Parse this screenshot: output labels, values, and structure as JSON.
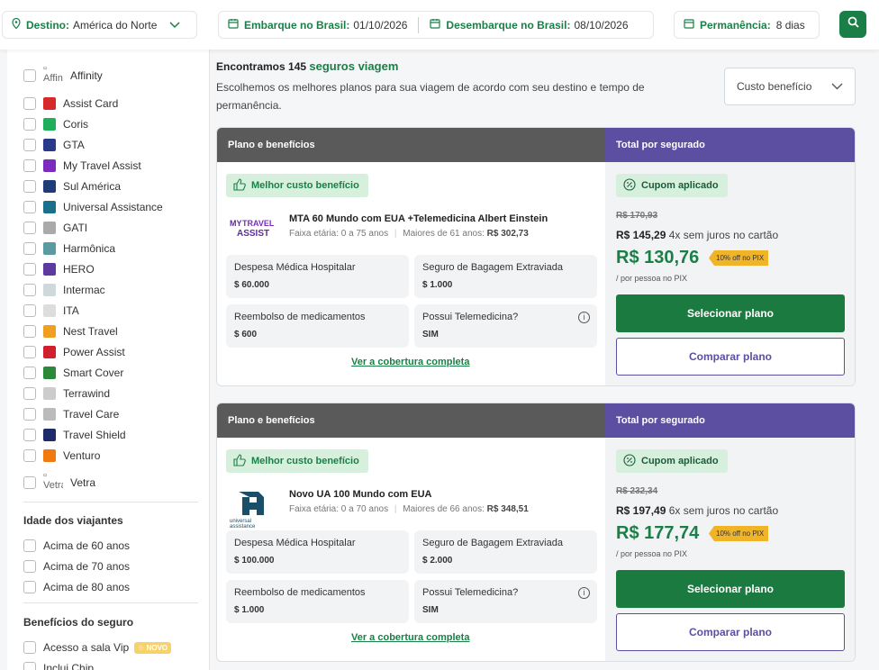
{
  "topbar": {
    "destino_label": "Destino:",
    "destino_value": "América do Norte",
    "embarque_label": "Embarque no Brasil:",
    "embarque_value": "01/10/2026",
    "desembarque_label": "Desembarque no Brasil:",
    "desembarque_value": "08/10/2026",
    "permanencia_label": "Permanência:",
    "permanencia_value": "8 dias"
  },
  "sidebar": {
    "insurers": [
      {
        "label": "Affinity",
        "alt": "Affini",
        "color": ""
      },
      {
        "label": "Assist Card",
        "color": "#d62a2a"
      },
      {
        "label": "Coris",
        "color": "#1fae5b"
      },
      {
        "label": "GTA",
        "color": "#2a3a8a"
      },
      {
        "label": "My Travel Assist",
        "color": "#7b2cbf"
      },
      {
        "label": "Sul América",
        "color": "#1e3c78"
      },
      {
        "label": "Universal Assistance",
        "color": "#1a6f8a"
      },
      {
        "label": "GATI",
        "color": "#aaaaaa"
      },
      {
        "label": "Harmônica",
        "color": "#5a9aa0"
      },
      {
        "label": "HERO",
        "color": "#5c3aa0"
      },
      {
        "label": "Intermac",
        "color": "#cfd8dc"
      },
      {
        "label": "ITA",
        "color": "#dddddd"
      },
      {
        "label": "Nest Travel",
        "color": "#f0a020"
      },
      {
        "label": "Power Assist",
        "color": "#d02030"
      },
      {
        "label": "Smart Cover",
        "color": "#2a8a3a"
      },
      {
        "label": "Terrawind",
        "color": "#cccccc"
      },
      {
        "label": "Travel Care",
        "color": "#bbbbbb"
      },
      {
        "label": "Travel Shield",
        "color": "#1e2a6a"
      },
      {
        "label": "Venturo",
        "color": "#f07a10"
      },
      {
        "label": "Vetra",
        "alt": "Vetra",
        "color": ""
      }
    ],
    "age_title": "Idade dos viajantes",
    "ages": [
      "Acima de 60 anos",
      "Acima de 70 anos",
      "Acima de 80 anos"
    ],
    "benefits_title": "Benefícios do seguro",
    "benefits": [
      {
        "label": "Acesso a sala Vip",
        "badge": "NOVO"
      },
      {
        "label": "Inclui Chip",
        "badge": ""
      }
    ]
  },
  "main": {
    "found_prefix": "Encontramos 145",
    "found_accent": "seguros viagem",
    "description": "Escolhemos os melhores planos para sua viagem de acordo com seu destino e tempo de permanência.",
    "sort_label": "Custo benefício"
  },
  "cards": [
    {
      "header_left": "Plano e benefícios",
      "header_right": "Total por segurado",
      "badge": "Melhor custo benefício",
      "name": "MTA 60 Mundo com EUA +Telemedicina Albert Einstein",
      "age_range": "Faixa etária: 0 a 75 anos",
      "over_label": "Maiores de 61 anos:",
      "over_value": "R$ 302,73",
      "benefits": [
        {
          "label": "Despesa Médica Hospitalar",
          "value": "$ 60.000"
        },
        {
          "label": "Seguro de Bagagem Extraviada",
          "value": "$ 1.000"
        },
        {
          "label": "Reembolso de medicamentos",
          "value": "$ 600"
        },
        {
          "label": "Possui Telemedicina?",
          "value": "SIM"
        }
      ],
      "coverage_link": "Ver a cobertura completa",
      "coupon": "Cupom aplicado",
      "old_price": "R$ 170,93",
      "installment_price": "R$ 145,29",
      "installment_text": "4x sem juros no cartão",
      "price": "R$ 130,76",
      "pix_badge": "10% off no PIX",
      "per_person": "/ por pessoa no PIX",
      "select_label": "Selecionar plano",
      "compare_label": "Comparar plano",
      "logo_text": "MYTRAVEL ASSIST"
    },
    {
      "header_left": "Plano e benefícios",
      "header_right": "Total por segurado",
      "badge": "Melhor custo benefício",
      "name": "Novo UA 100 Mundo com EUA",
      "age_range": "Faixa etária: 0 a 70 anos",
      "over_label": "Maiores de 66 anos:",
      "over_value": "R$ 348,51",
      "benefits": [
        {
          "label": "Despesa Médica Hospitalar",
          "value": "$ 100.000"
        },
        {
          "label": "Seguro de Bagagem Extraviada",
          "value": "$ 2.000"
        },
        {
          "label": "Reembolso de medicamentos",
          "value": "$ 1.000"
        },
        {
          "label": "Possui Telemedicina?",
          "value": "SIM"
        }
      ],
      "coverage_link": "Ver a cobertura completa",
      "coupon": "Cupom aplicado",
      "old_price": "R$ 232,34",
      "installment_price": "R$ 197,49",
      "installment_text": "6x sem juros no cartão",
      "price": "R$ 177,74",
      "pix_badge": "10% off no PIX",
      "per_person": "/ por pessoa no PIX",
      "select_label": "Selecionar plano",
      "compare_label": "Comparar plano",
      "logo_text": "universal assistance"
    }
  ]
}
